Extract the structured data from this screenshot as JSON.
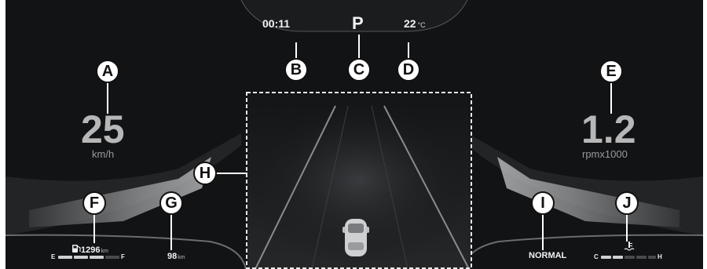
{
  "status_bar": {
    "clock": "00:11",
    "gear": "P",
    "outside_temp": "22",
    "temp_unit": "°C"
  },
  "speedometer": {
    "value": "25",
    "unit": "km/h"
  },
  "tachometer": {
    "value": "1.2",
    "unit": "rpmx1000"
  },
  "fuel": {
    "range_value": "1296",
    "range_unit": "km",
    "empty_label": "E",
    "full_label": "F",
    "level_fraction": 0.75
  },
  "trip": {
    "value": "98",
    "unit": "km"
  },
  "drive_mode": "NORMAL",
  "coolant": {
    "cold_label": "C",
    "hot_label": "H",
    "level_fraction": 0.4
  },
  "callouts": [
    "A",
    "B",
    "C",
    "D",
    "E",
    "F",
    "G",
    "H",
    "I",
    "J"
  ],
  "icons": {
    "fuel": "fuel-pump-icon",
    "coolant": "coolant-temp-icon",
    "vehicle": "car-icon"
  },
  "colors": {
    "background": "#121315",
    "text": "#f2f2f2",
    "gauge_text": "#b7b7b7",
    "bar_active": "#d0d0d0",
    "bar_inactive": "#4a4a4a"
  }
}
